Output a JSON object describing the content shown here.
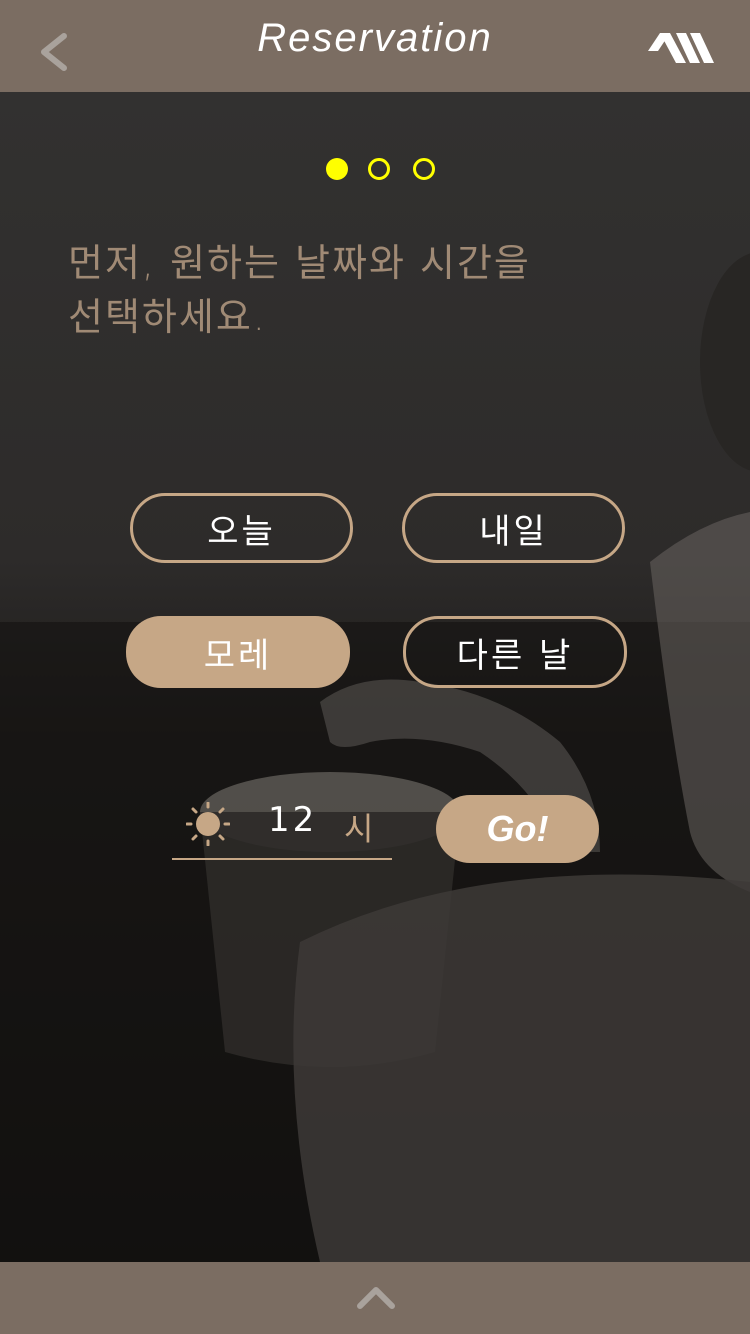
{
  "header": {
    "title": "Reservation",
    "back_icon": "chevron-left-icon",
    "logo": "brand-logo"
  },
  "progress": {
    "steps": 3,
    "current": 1
  },
  "instruction": {
    "line1": "먼저, 원하는 날짜와 시간을",
    "line2": "선택하세요."
  },
  "days": [
    {
      "label": "오늘",
      "selected": false
    },
    {
      "label": "내일",
      "selected": false
    },
    {
      "label": "모레",
      "selected": true
    },
    {
      "label": "다른 날",
      "selected": false
    }
  ],
  "time": {
    "icon": "sun-icon",
    "value": "12",
    "unit": "시"
  },
  "go_label": "Go!",
  "footer": {
    "icon": "chevron-up-icon"
  },
  "colors": {
    "bar": "#7b6d62",
    "accent": "#c6a786",
    "dot": "#ffff00",
    "instruction": "#a08a75"
  }
}
